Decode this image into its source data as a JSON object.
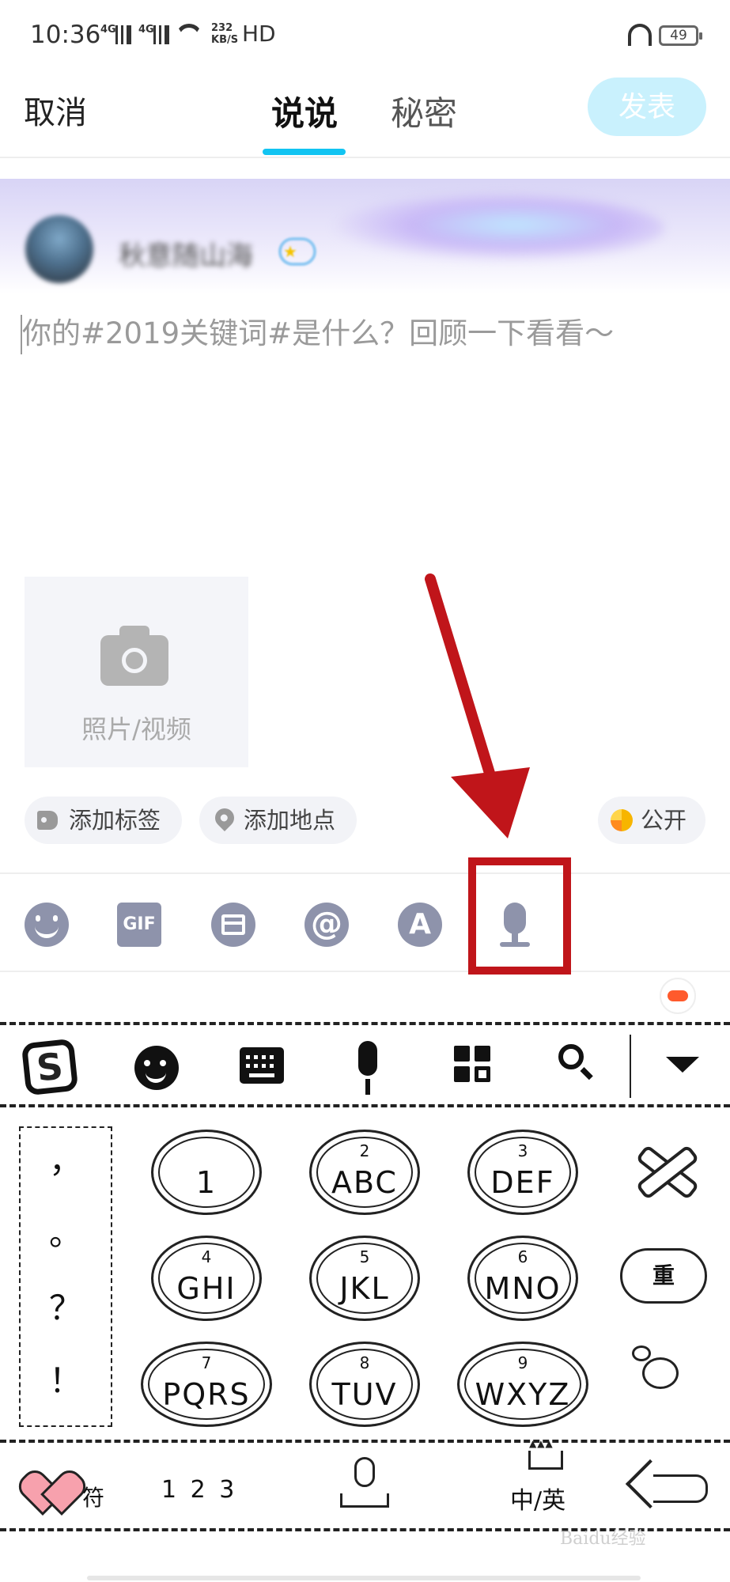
{
  "status_bar": {
    "time": "10:36",
    "sim1": "4G",
    "sim2": "4G",
    "net_speed": "232",
    "net_unit": "KB/S",
    "hd": "HD",
    "battery": "49"
  },
  "header": {
    "cancel": "取消",
    "tabs": [
      {
        "label": "说说",
        "active": true
      },
      {
        "label": "秘密",
        "active": false
      }
    ],
    "publish": "发表",
    "accent_color": "#12c4f2"
  },
  "profile": {
    "name": "秋意随山海"
  },
  "composer": {
    "placeholder": "你的#2019关键词#是什么？回顾一下看看～",
    "value": ""
  },
  "media": {
    "label": "照片/视频",
    "icon": "camera-icon"
  },
  "chips": {
    "add_tag": "添加标签",
    "add_location": "添加地点",
    "visibility": "公开"
  },
  "toolbar": {
    "gif": "GIF",
    "at": "@",
    "font": "A",
    "icons": [
      "emoji-icon",
      "gif-icon",
      "frame-icon",
      "at-icon",
      "font-icon",
      "microphone-icon"
    ],
    "highlight_color": "#c0151a"
  },
  "keyboard": {
    "logo": "S",
    "punctuation": [
      "，",
      "。",
      "？",
      "！"
    ],
    "keys": [
      {
        "num": "",
        "letters": "1"
      },
      {
        "num": "2",
        "letters": "ABC"
      },
      {
        "num": "3",
        "letters": "DEF"
      },
      {
        "num": "4",
        "letters": "GHI"
      },
      {
        "num": "5",
        "letters": "JKL"
      },
      {
        "num": "6",
        "letters": "MNO"
      },
      {
        "num": "7",
        "letters": "PQRS"
      },
      {
        "num": "8",
        "letters": "TUV"
      },
      {
        "num": "9",
        "letters": "WXYZ"
      }
    ],
    "reenter": "重",
    "symbols": "符",
    "numbers": "1 2 3",
    "lang": "中/英",
    "watermark": "Baidu经验"
  }
}
